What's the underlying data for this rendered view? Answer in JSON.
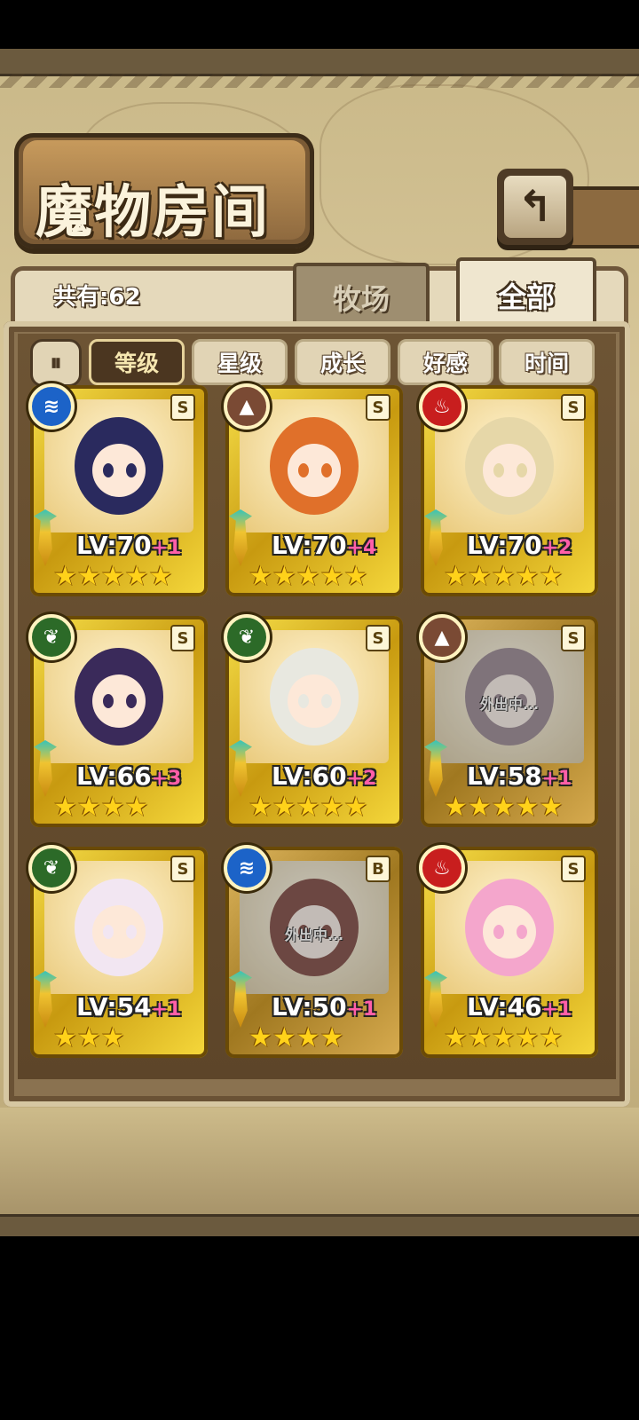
{
  "title": "魔物房间",
  "back_button_icon": "return-arrow-icon",
  "count_label": "共有:62",
  "tabs": [
    {
      "label": "牧场",
      "active": false
    },
    {
      "label": "全部",
      "active": true
    }
  ],
  "sort_toggle_icon": "sort-order-icon",
  "filters": [
    {
      "label": "等级",
      "active": true
    },
    {
      "label": "星级",
      "active": false
    },
    {
      "label": "成长",
      "active": false
    },
    {
      "label": "好感",
      "active": false
    },
    {
      "label": "时间",
      "active": false
    }
  ],
  "cards": [
    {
      "element": "water-icon",
      "element_color": "#1c63c8",
      "rank": "S",
      "level": "LV:70",
      "bonus": "+1",
      "stars": "★★★★★",
      "away": "",
      "hair": "#2a2a5e"
    },
    {
      "element": "earth-icon",
      "element_color": "#7a4a34",
      "rank": "S",
      "level": "LV:70",
      "bonus": "+4",
      "stars": "★★★★★",
      "away": "",
      "hair": "#e0702a"
    },
    {
      "element": "fire-icon",
      "element_color": "#c81e1e",
      "rank": "S",
      "level": "LV:70",
      "bonus": "+2",
      "stars": "★★★★★",
      "away": "",
      "hair": "#e6d7a8"
    },
    {
      "element": "leaf-icon",
      "element_color": "#2c6a28",
      "rank": "S",
      "level": "LV:66",
      "bonus": "+3",
      "stars": "★★★★",
      "away": "",
      "hair": "#3a2a5a"
    },
    {
      "element": "leaf-icon",
      "element_color": "#2c6a28",
      "rank": "S",
      "level": "LV:60",
      "bonus": "+2",
      "stars": "★★★★★",
      "away": "",
      "hair": "#e8e8e0"
    },
    {
      "element": "earth-icon",
      "element_color": "#7a4a34",
      "rank": "S",
      "level": "LV:58",
      "bonus": "+1",
      "stars": "★★★★★",
      "away": "外出中...",
      "hair": "#b08aa0"
    },
    {
      "element": "leaf-icon",
      "element_color": "#2c6a28",
      "rank": "S",
      "level": "LV:54",
      "bonus": "+1",
      "stars": "★★★",
      "away": "",
      "hair": "#f2e6f2"
    },
    {
      "element": "water-icon",
      "element_color": "#1c63c8",
      "rank": "B",
      "level": "LV:50",
      "bonus": "+1",
      "stars": "★★★★",
      "away": "外出中...",
      "hair": "#c04a3a"
    },
    {
      "element": "fire-icon",
      "element_color": "#c81e1e",
      "rank": "S",
      "level": "LV:46",
      "bonus": "+1",
      "stars": "★★★★★",
      "away": "",
      "hair": "#f4a6cc"
    }
  ]
}
